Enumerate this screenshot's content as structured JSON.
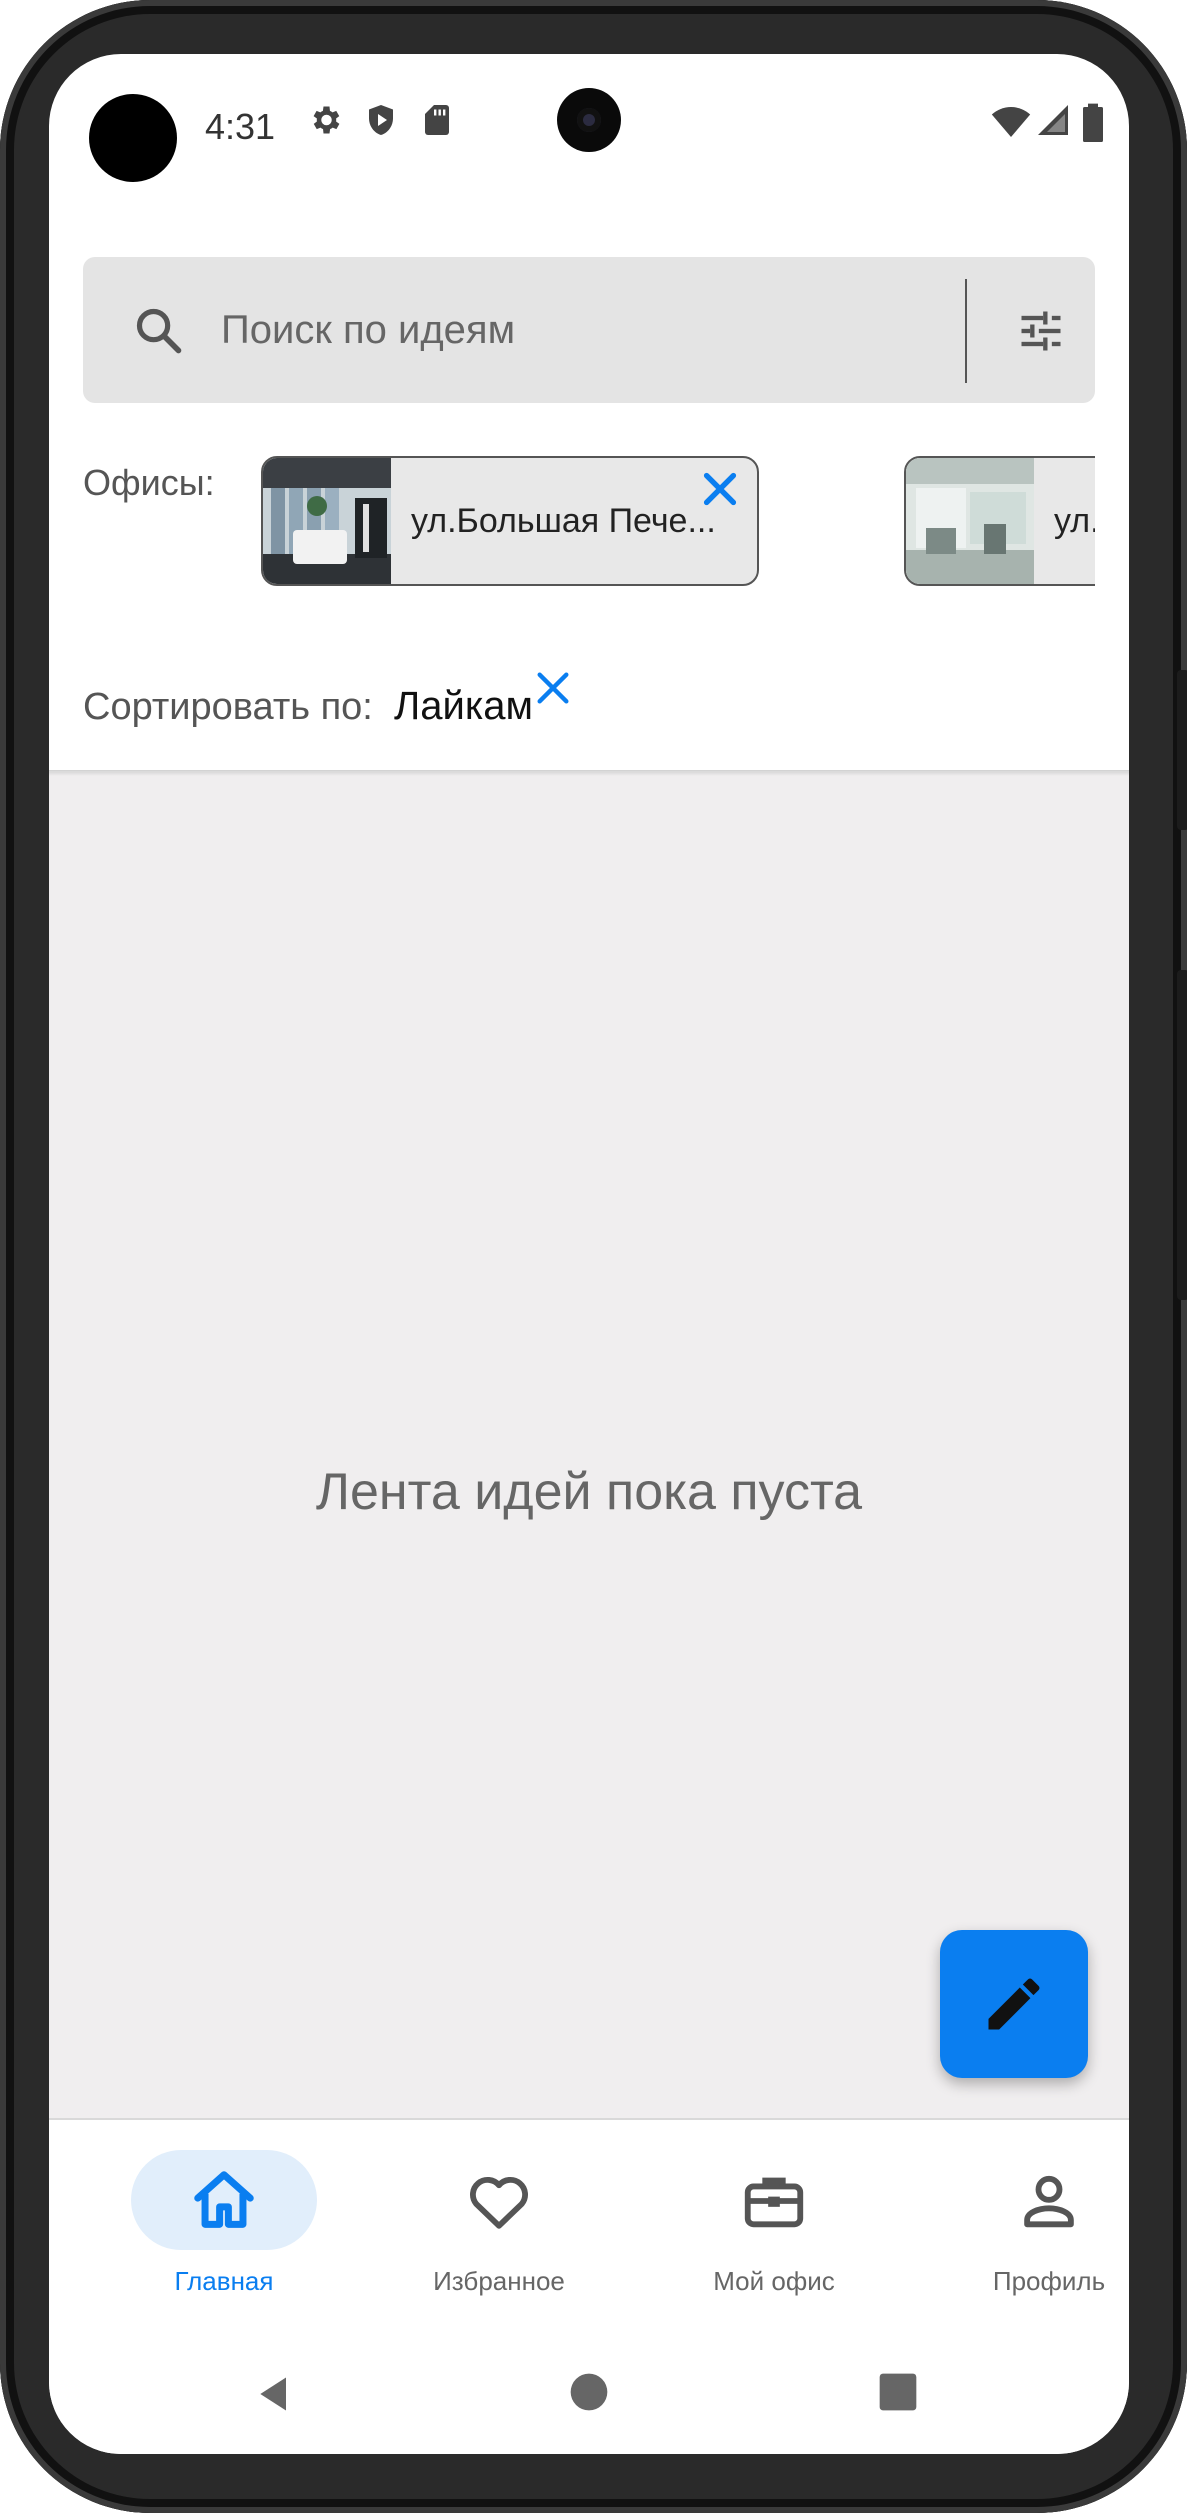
{
  "status_bar": {
    "time": "4:31",
    "left_icons": [
      "gear-icon",
      "shield-play-icon",
      "sd-card-icon"
    ],
    "right_icons": [
      "wifi-icon",
      "signal-icon",
      "battery-icon"
    ]
  },
  "search": {
    "placeholder": "Поиск по идеям",
    "value": "",
    "filter_icon": "tune-icon"
  },
  "offices": {
    "label": "Офисы:",
    "items": [
      {
        "name": "ул.Большая Пече...",
        "removable": true
      },
      {
        "name": "ул.",
        "removable": false
      }
    ]
  },
  "sort": {
    "label": "Сортировать по:",
    "value": "Лайкам"
  },
  "feed": {
    "empty_message": "Лента идей пока пуста"
  },
  "fab": {
    "icon": "pencil-icon"
  },
  "bottom_nav": {
    "items": [
      {
        "label": "Главная",
        "icon": "home-icon",
        "active": true
      },
      {
        "label": "Избранное",
        "icon": "heart-icon",
        "active": false
      },
      {
        "label": "Мой офис",
        "icon": "briefcase-icon",
        "active": false
      },
      {
        "label": "Профиль",
        "icon": "person-icon",
        "active": false
      }
    ]
  },
  "colors": {
    "accent": "#0a7ef0",
    "search_bg": "#e4e4e4",
    "feed_bg": "#f0eeef",
    "active_pill": "#e1eefb"
  }
}
